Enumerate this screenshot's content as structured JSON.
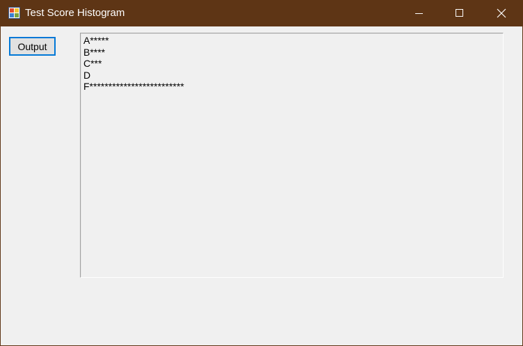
{
  "window": {
    "title": "Test Score Histogram",
    "icon": "winforms-app-icon",
    "controls": [
      "minimize-icon",
      "maximize-icon",
      "close-icon"
    ]
  },
  "output_button": {
    "label": "Output"
  },
  "histogram": {
    "lines": [
      "A*****",
      "B****",
      "C***",
      "D",
      "F*************************"
    ]
  },
  "colors": {
    "titlebar": "#5e3515",
    "client_background": "#f0f0f0",
    "button_focus_border": "#0078d7"
  }
}
